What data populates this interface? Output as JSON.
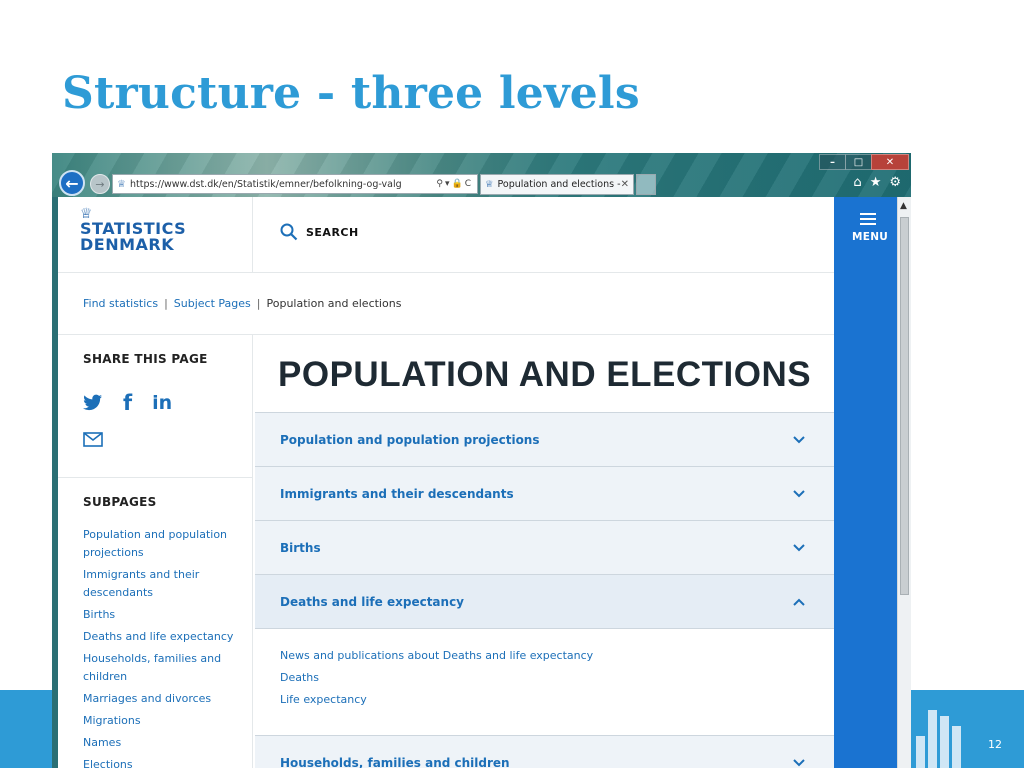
{
  "slide": {
    "title": "Structure - three levels",
    "page_number": "12"
  },
  "browser": {
    "window_controls": [
      "–",
      "□",
      "✕"
    ],
    "address_url": "https://www.dst.dk/en/Statistik/emner/befolkning-og-valg",
    "tab_title": "Population and elections - ..."
  },
  "site": {
    "logo_line1": "STATISTICS",
    "logo_line2": "DENMARK",
    "search_label": "SEARCH",
    "menu_label": "MENU",
    "breadcrumb": [
      "Find statistics",
      "Subject Pages",
      "Population and elections"
    ],
    "share_heading": "SHARE THIS PAGE",
    "social": [
      "twitter-icon",
      "facebook-icon",
      "linkedin-icon",
      "mail-icon"
    ],
    "subpages_heading": "SUBPAGES",
    "subpages": [
      "Population and population projections",
      "Immigrants and their descendants",
      "Births",
      "Deaths and life expectancy",
      "Households, families and children",
      "Marriages and divorces",
      "Migrations",
      "Names",
      "Elections"
    ],
    "page_heading": "POPULATION AND ELECTIONS",
    "accordion": [
      {
        "label": "Population and population projections",
        "open": false
      },
      {
        "label": "Immigrants and their descendants",
        "open": false
      },
      {
        "label": "Births",
        "open": false
      },
      {
        "label": "Deaths and life expectancy",
        "open": true
      },
      {
        "label": "Households, families and children",
        "open": false
      }
    ],
    "expanded_links": [
      "News and publications about Deaths and life expectancy",
      "Deaths",
      "Life expectancy"
    ]
  },
  "colors": {
    "slide_accent": "#2e9bd6",
    "site_blue": "#1c6fb8",
    "menu_blue": "#1a73d1"
  }
}
